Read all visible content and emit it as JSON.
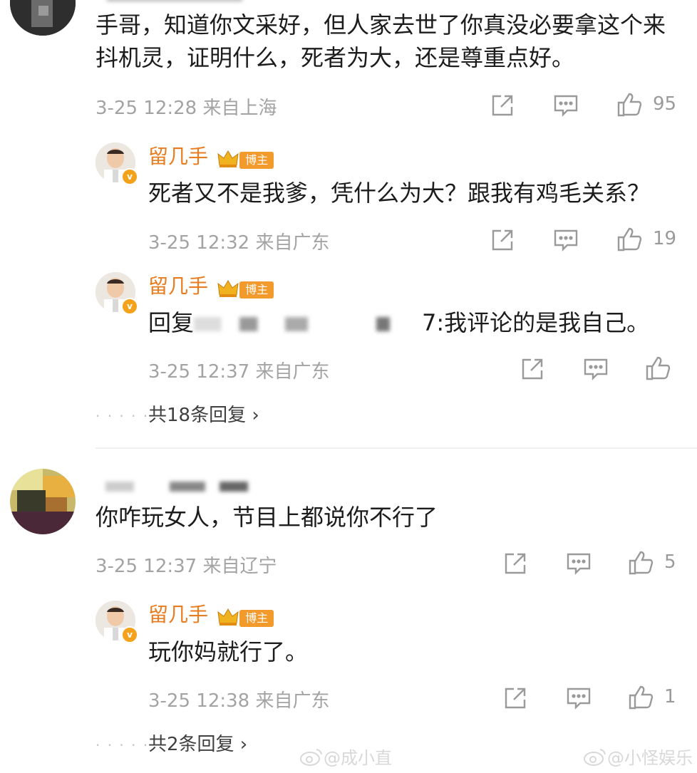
{
  "comments": [
    {
      "text": "手哥，知道你文采好，但人家去世了你真没必要拿这个来抖机灵，证明什么，死者为大，还是尊重点好。",
      "time": "3-25 12:28",
      "location": "来自上海",
      "likes": "95"
    },
    {
      "text": "你咋玩女人，节目上都说你不行了",
      "time": "3-25 12:37",
      "location": "来自辽宁",
      "likes": "5"
    }
  ],
  "replies": [
    {
      "author": "留几手",
      "tag": "博主",
      "text": "死者又不是我爹，凭什么为大？跟我有鸡毛关系？",
      "time": "3-25 12:32",
      "location": "来自广东",
      "likes": "19"
    },
    {
      "author": "留几手",
      "tag": "博主",
      "reply_prefix": "回复",
      "reply_suffix": "7:我评论的是我自己。",
      "time": "3-25 12:37",
      "location": "来自广东",
      "likes": ""
    },
    {
      "author": "留几手",
      "tag": "博主",
      "text": "玩你妈就行了。",
      "time": "3-25 12:38",
      "location": "来自广东",
      "likes": "1"
    }
  ],
  "more_replies": [
    "共18条回复 ›",
    "共2条回复 ›"
  ],
  "watermarks": [
    "@成小直",
    "@小怪娱乐"
  ],
  "colors": {
    "author": "#e87c1e",
    "tag": "#f39a2d",
    "meta": "#a3a3a3"
  },
  "icons": [
    "share-icon",
    "comment-icon",
    "like-icon",
    "crown-icon",
    "verified-badge-icon",
    "weibo-logo-icon"
  ]
}
